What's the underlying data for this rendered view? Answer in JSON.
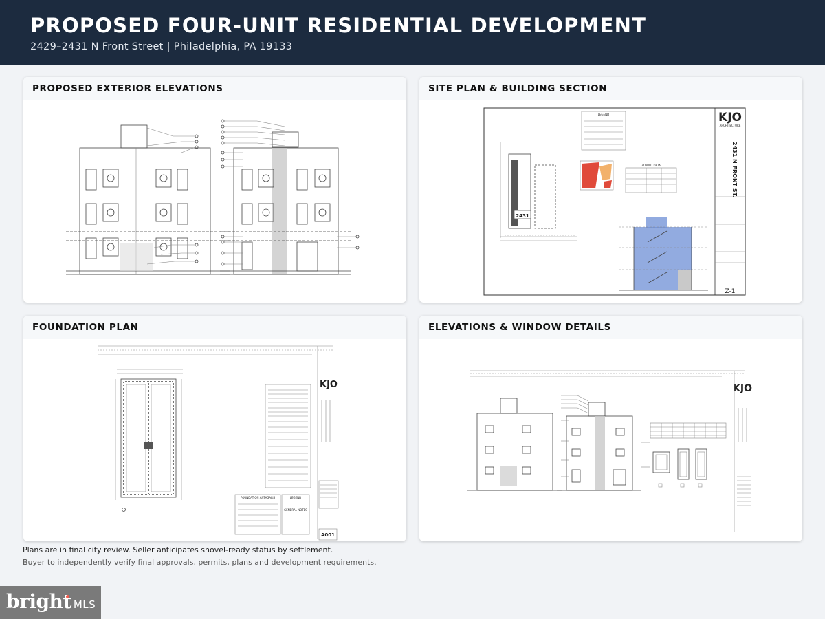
{
  "header": {
    "title": "PROPOSED FOUR-UNIT RESIDENTIAL DEVELOPMENT",
    "subtitle": "2429–2431 N Front Street  |  Philadelphia, PA 19133"
  },
  "panels": [
    {
      "title": "PROPOSED EXTERIOR ELEVATIONS"
    },
    {
      "title": "SITE PLAN & BUILDING SECTION"
    },
    {
      "title": "FOUNDATION PLAN"
    },
    {
      "title": "ELEVATIONS & WINDOW DETAILS"
    }
  ],
  "drawings": {
    "site_lot_number": "2431",
    "site_brand": "KJO",
    "site_brand_sub": "ARCHITECTURE",
    "site_address_vertical": "2431 N FRONT ST.",
    "site_sheet": "Z-1",
    "site_legend": "LEGEND",
    "site_zoning": "ZONING DATA",
    "foundation_sheet": "A001",
    "foundation_brand": "KJO",
    "foundation_table_title": "FOUNDATION ANTAGALIS",
    "foundation_legend": "LEGEND",
    "foundation_notes": "GENERAL NOTES",
    "details_brand": "KJO"
  },
  "footer": {
    "note_primary": "Plans are in final city review. Seller anticipates shovel-ready status by settlement.",
    "note_secondary": "Buyer to independently verify final approvals, permits, plans and development requirements."
  },
  "watermark": {
    "brand": "bright",
    "suffix": "MLS"
  },
  "colors": {
    "header_bg": "#1c2b3f",
    "section_blue": "#6d8fd6",
    "site_red": "#e04a3a",
    "badge_bg": "#7a7a7a",
    "badge_dot": "#ef5a4c"
  }
}
